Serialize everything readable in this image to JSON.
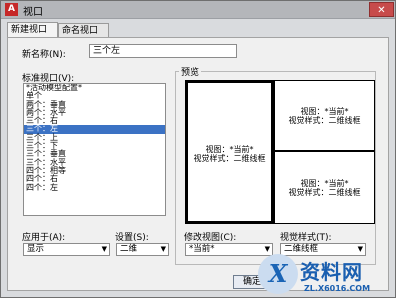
{
  "window": {
    "title": "视口",
    "close_glyph": "✕",
    "app_glyph": "A"
  },
  "tabs": [
    "新建视口",
    "命名视口"
  ],
  "new_name": {
    "label": "新名称(N):",
    "value": "三个左"
  },
  "std_viewports": {
    "label": "标准视口(V):",
    "items": [
      "*活动模型配置*",
      "单个",
      "两个：垂直",
      "两个：水平",
      "三个：右",
      "三个：左",
      "三个：上",
      "三个：下",
      "三个：垂直",
      "三个：水平",
      "四个：相等",
      "四个：右",
      "四个：左"
    ],
    "selected_index": 5
  },
  "preview": {
    "label": "预览",
    "panes": [
      {
        "view": "视图：*当前*",
        "style": "视觉样式：二维线框"
      },
      {
        "view": "视图：*当前*",
        "style": "视觉样式：二维线框"
      },
      {
        "view": "视图：*当前*",
        "style": "视觉样式：二维线框"
      }
    ]
  },
  "apply_to": {
    "label": "应用于(A):",
    "value": "显示"
  },
  "setup": {
    "label": "设置(S):",
    "value": "二维"
  },
  "change_view": {
    "label": "修改视图(C):",
    "value": "*当前*"
  },
  "visual_style": {
    "label": "视觉样式(T):",
    "value": "二维线框"
  },
  "buttons": {
    "ok": "确定"
  },
  "watermark": {
    "mark": "X",
    "big": "资料网",
    "small": "ZL.X6016.COM"
  }
}
